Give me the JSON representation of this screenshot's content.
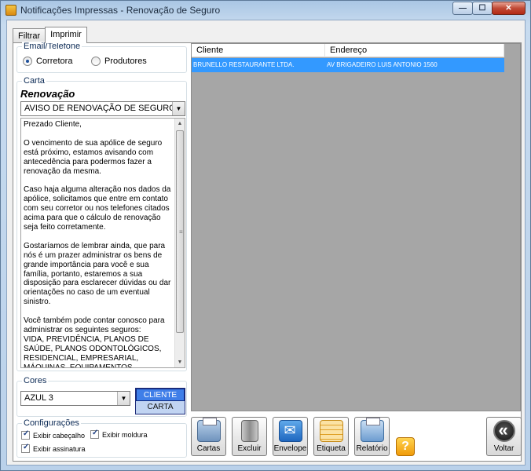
{
  "window": {
    "title": "Notificações Impressas - Renovação de Seguro",
    "controls": [
      "minimize",
      "maximize",
      "close"
    ]
  },
  "tabs": [
    {
      "label": "Filtrar",
      "active": false
    },
    {
      "label": "Imprimir",
      "active": true
    }
  ],
  "email_group": {
    "legend": "Email/Telefone",
    "options": [
      {
        "label": "Corretora",
        "selected": true
      },
      {
        "label": "Produtores",
        "selected": false
      }
    ]
  },
  "carta_group": {
    "legend": "Carta",
    "title": "Renovação",
    "selected_letter": "AVISO DE RENOVAÇÃO DE SEGURO",
    "body": "Prezado Cliente,\n\nO vencimento de sua apólice de seguro está próximo, estamos avisando com antecedência para podermos fazer a renovação da mesma.\n\nCaso haja alguma alteração nos dados da apólice, solicitamos que entre em contato com seu corretor ou nos telefones citados acima para que o cálculo de renovação seja feito corretamente.\n\nGostaríamos de lembrar ainda, que para nós é um prazer administrar os bens de grande importância para você e sua família, portanto, estaremos a sua disposição para esclarecer dúvidas ou dar orientações no caso de um eventual sinistro.\n\nVocê também pode contar conosco para administrar os seguintes seguros:\nVIDA, PREVIDÊNCIA, PLANOS DE SAÚDE, PLANOS ODONTOLÓGICOS, RESIDENCIAL, EMPRESARIAL, MÁQUINAS, EQUIPAMENTOS DIVERSOS E AUTOMÓVEL"
  },
  "cores_group": {
    "legend": "Cores",
    "selected_color": "AZUL 3",
    "targets": [
      {
        "label": "CLIENTE",
        "selected": true
      },
      {
        "label": "CARTA",
        "selected": false
      }
    ]
  },
  "config_group": {
    "legend": "Configurações",
    "checks": [
      {
        "label": "Exibir cabeçalho",
        "checked": true
      },
      {
        "label": "Exibir moldura",
        "checked": true
      },
      {
        "label": "Exibir assinatura",
        "checked": true
      }
    ]
  },
  "grid": {
    "columns": [
      "Cliente",
      "Endereço"
    ],
    "rows": [
      {
        "cliente": "BRUNELLO RESTAURANTE LTDA.",
        "endereco": "AV BRIGADEIRO LUIS ANTONIO 1560"
      }
    ]
  },
  "toolbar": {
    "cartas": "Cartas",
    "excluir": "Excluir",
    "envelope": "Envelope",
    "etiqueta": "Etiqueta",
    "relatorio": "Relatório",
    "help": "?",
    "voltar": "Voltar"
  },
  "colors": {
    "selection": "#3399ff",
    "grid_background": "#a6a6a6",
    "color_selected": "#3f7ee8"
  }
}
